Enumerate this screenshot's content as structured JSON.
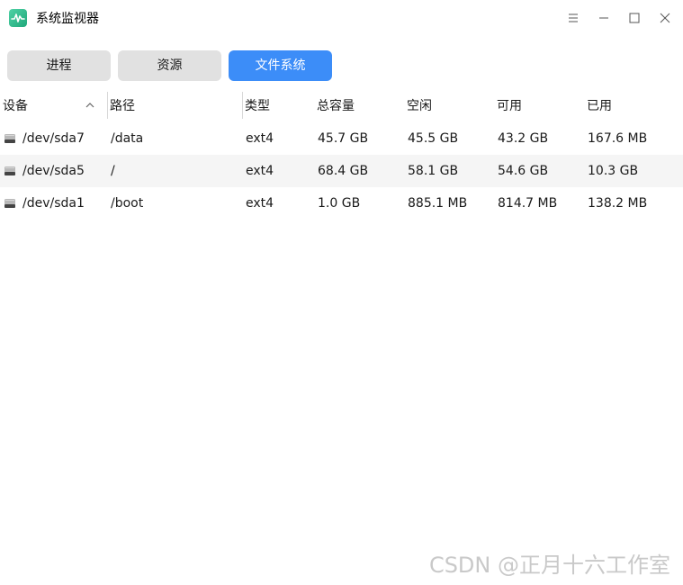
{
  "window": {
    "title": "系统监视器"
  },
  "tabs": [
    {
      "label": "进程"
    },
    {
      "label": "资源"
    },
    {
      "label": "文件系统"
    }
  ],
  "table": {
    "columns": [
      "设备",
      "路径",
      "类型",
      "总容量",
      "空闲",
      "可用",
      "已用"
    ],
    "rows": [
      {
        "device": "/dev/sda7",
        "path": "/data",
        "type": "ext4",
        "total": "45.7 GB",
        "free": "45.5 GB",
        "available": "43.2 GB",
        "used": "167.6 MB"
      },
      {
        "device": "/dev/sda5",
        "path": "/",
        "type": "ext4",
        "total": "68.4 GB",
        "free": "58.1 GB",
        "available": "54.6 GB",
        "used": "10.3 GB"
      },
      {
        "device": "/dev/sda1",
        "path": "/boot",
        "type": "ext4",
        "total": "1.0 GB",
        "free": "885.1 MB",
        "available": "814.7 MB",
        "used": "138.2 MB"
      }
    ]
  },
  "watermark": "CSDN @正月十六工作室",
  "colors": {
    "accent": "#3c8df8",
    "tab_inactive": "#e1e1e1",
    "row_alt": "#f5f5f5"
  }
}
